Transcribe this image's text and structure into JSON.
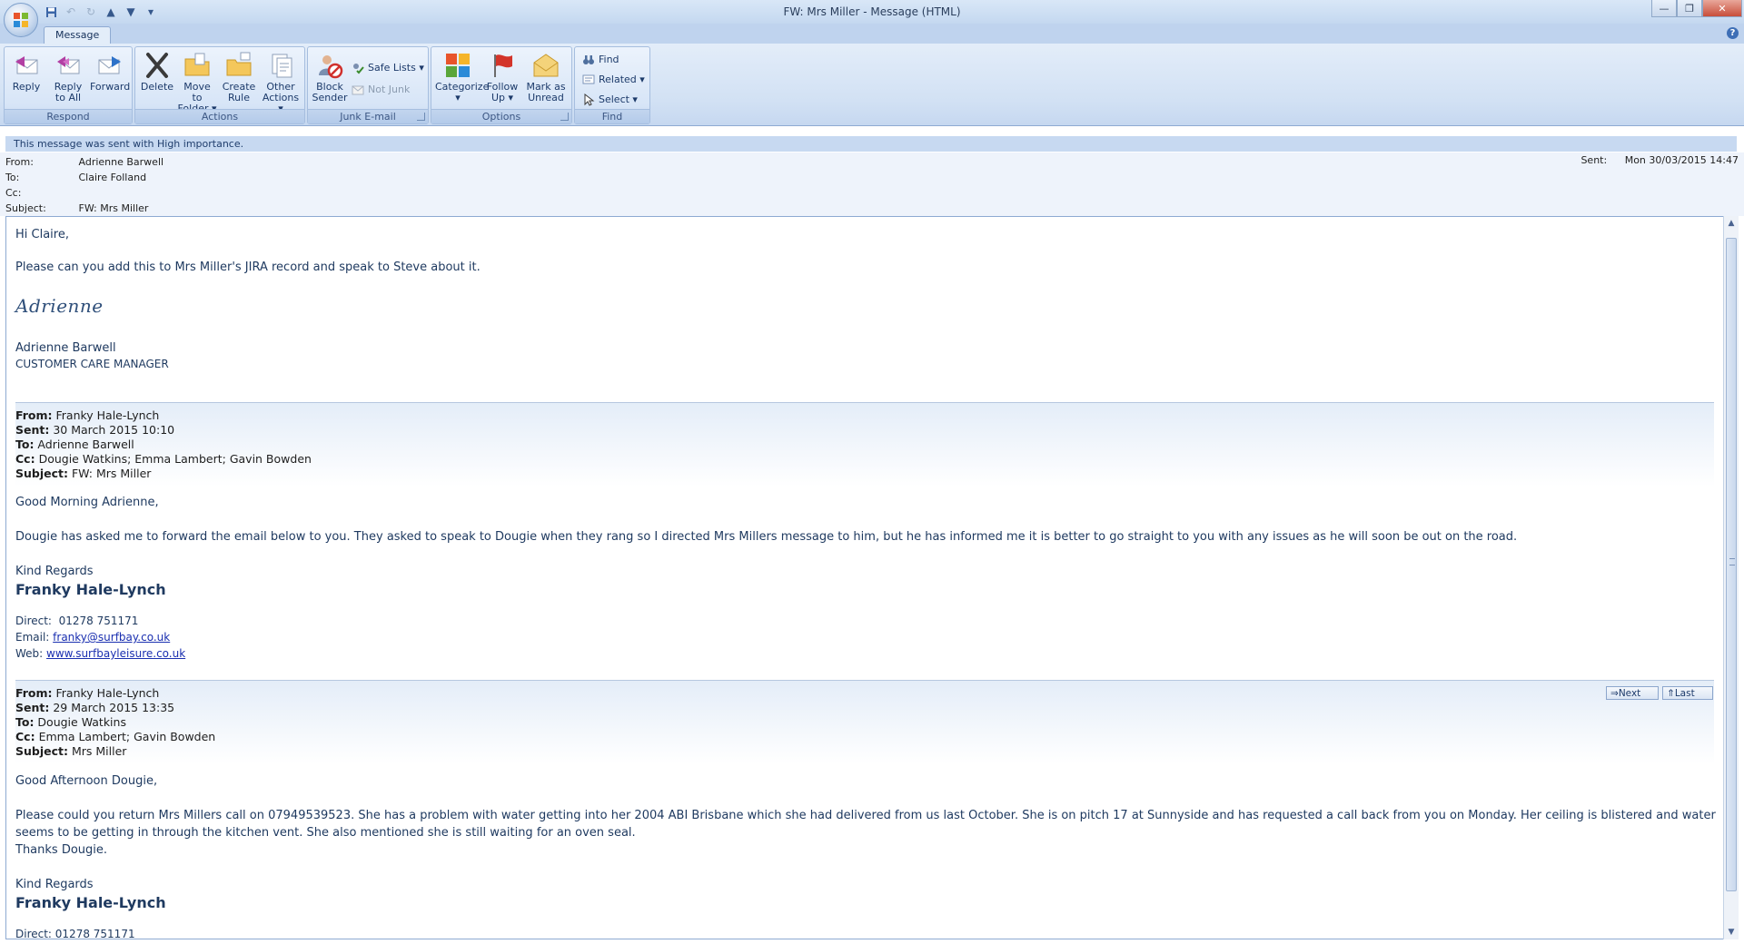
{
  "window": {
    "title": "FW: Mrs Miller - Message (HTML)",
    "help": "?"
  },
  "ribbon": {
    "tab": "Message",
    "groups": {
      "respond": "Respond",
      "actions": "Actions",
      "junk": "Junk E-mail",
      "options": "Options",
      "find": "Find"
    },
    "buttons": {
      "reply": "Reply",
      "reply_all": "Reply\nto All",
      "forward": "Forward",
      "delete": "Delete",
      "move": "Move to\nFolder ▾",
      "create_rule": "Create\nRule",
      "other_actions": "Other\nActions ▾",
      "block_sender": "Block\nSender",
      "safe_lists": "Safe Lists ▾",
      "not_junk": "Not Junk",
      "categorize": "Categorize\n▾",
      "follow_up": "Follow\nUp ▾",
      "mark_unread": "Mark as\nUnread",
      "find": "Find",
      "related": "Related ▾",
      "select": "Select ▾"
    }
  },
  "infobar": "This message was sent with High importance.",
  "header": {
    "from_label": "From:",
    "from": "Adrienne Barwell",
    "to_label": "To:",
    "to": "Claire Folland",
    "cc_label": "Cc:",
    "cc": "",
    "subject_label": "Subject:",
    "subject": "FW: Mrs Miller",
    "sent_label": "Sent:",
    "sent": "Mon 30/03/2015 14:47"
  },
  "body": {
    "greeting": "Hi Claire,",
    "line1": "Please can you add this to Mrs Miller's JIRA record and speak to Steve about it.",
    "signature_script": "Adrienne",
    "sig_name": "Adrienne Barwell",
    "sig_title": "CUSTOMER CARE MANAGER",
    "fw1": {
      "from_label": "From:",
      "from": " Franky Hale-Lynch",
      "sent_label": "Sent:",
      "sent": " 30 March 2015 10:10",
      "to_label": "To:",
      "to": " Adrienne Barwell",
      "cc_label": "Cc:",
      "cc": " Dougie Watkins; Emma Lambert; Gavin Bowden",
      "subject_label": "Subject:",
      "subject": " FW: Mrs Miller",
      "greeting": "Good Morning Adrienne,",
      "text": "Dougie has asked me to forward the email below to you. They asked to speak to Dougie when they rang so I directed Mrs Millers message to him, but he has informed me it is better to go straight to you with any issues as he will soon be out on the road.",
      "regards": "Kind Regards",
      "name": "Franky Hale-Lynch",
      "direct_label": "Direct:",
      "direct": "01278 751171",
      "email_label": "Email:",
      "email": "franky@surfbay.co.uk",
      "web_label": "Web:",
      "web": "www.surfbayleisure.co.uk"
    },
    "fw2": {
      "from_label": "From:",
      "from": " Franky Hale-Lynch",
      "sent_label": "Sent:",
      "sent": " 29 March 2015 13:35",
      "to_label": "To:",
      "to": " Dougie Watkins",
      "cc_label": "Cc:",
      "cc": " Emma Lambert; Gavin Bowden",
      "subject_label": "Subject:",
      "subject": " Mrs Miller",
      "next": "Next",
      "last": "Last",
      "greeting": "Good Afternoon Dougie,",
      "text1": "Please could you return Mrs Millers call on 07949539523. She has a problem with water getting into her 2004 ABI Brisbane which she had delivered from us last October. She is on pitch 17 at Sunnyside and has requested a call back from you on Monday. Her ceiling is blistered and water",
      "text2": "seems to be getting in through the kitchen vent. She also mentioned she is still waiting for an oven seal.",
      "thanks": "Thanks Dougie.",
      "regards": "Kind Regards",
      "name": "Franky Hale-Lynch",
      "direct_partial": "Direct:  01278 751171"
    }
  },
  "colors": {
    "accent": "#1f3a60",
    "ribbon": "#d2e1f4",
    "link": "#1a2fb0"
  }
}
